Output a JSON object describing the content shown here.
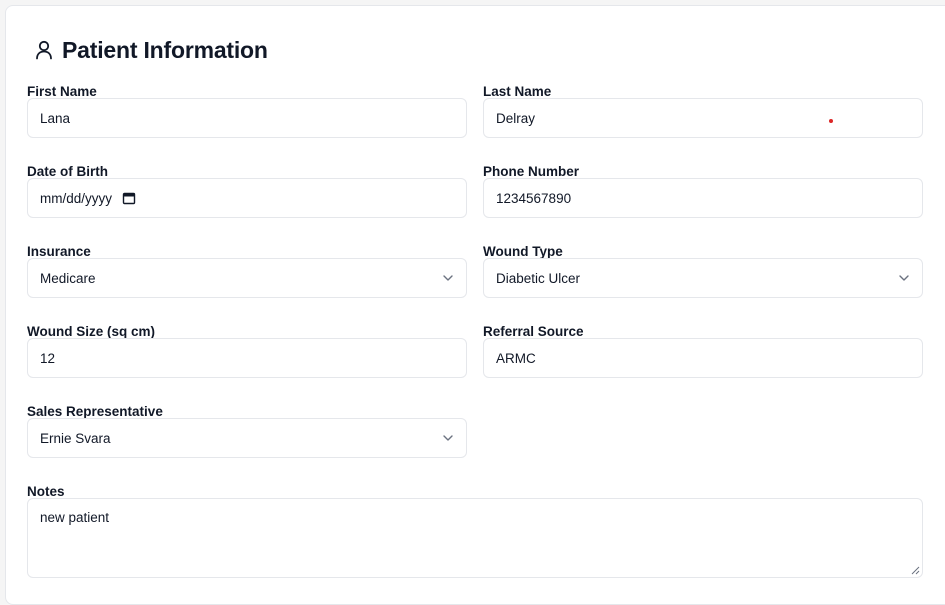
{
  "header": {
    "title": "Patient Information",
    "icon": "user-icon"
  },
  "fields": {
    "first_name": {
      "label": "First Name",
      "value": "Lana"
    },
    "last_name": {
      "label": "Last Name",
      "value": "Delray"
    },
    "date_of_birth": {
      "label": "Date of Birth",
      "placeholder": "mm/dd/yyyy",
      "icon": "calendar-icon"
    },
    "phone_number": {
      "label": "Phone Number",
      "value": "1234567890"
    },
    "insurance": {
      "label": "Insurance",
      "value": "Medicare",
      "icon": "chevron-down-icon"
    },
    "wound_type": {
      "label": "Wound Type",
      "value": "Diabetic Ulcer",
      "icon": "chevron-down-icon"
    },
    "wound_size": {
      "label": "Wound Size (sq cm)",
      "value": "12"
    },
    "referral_source": {
      "label": "Referral Source",
      "value": "ARMC"
    },
    "sales_rep": {
      "label": "Sales Representative",
      "value": "Ernie Svara",
      "icon": "chevron-down-icon"
    },
    "notes": {
      "label": "Notes",
      "value": "new patient"
    }
  },
  "colors": {
    "border": "#e5e7eb",
    "text": "#111827",
    "indicator": "#dc2626"
  }
}
